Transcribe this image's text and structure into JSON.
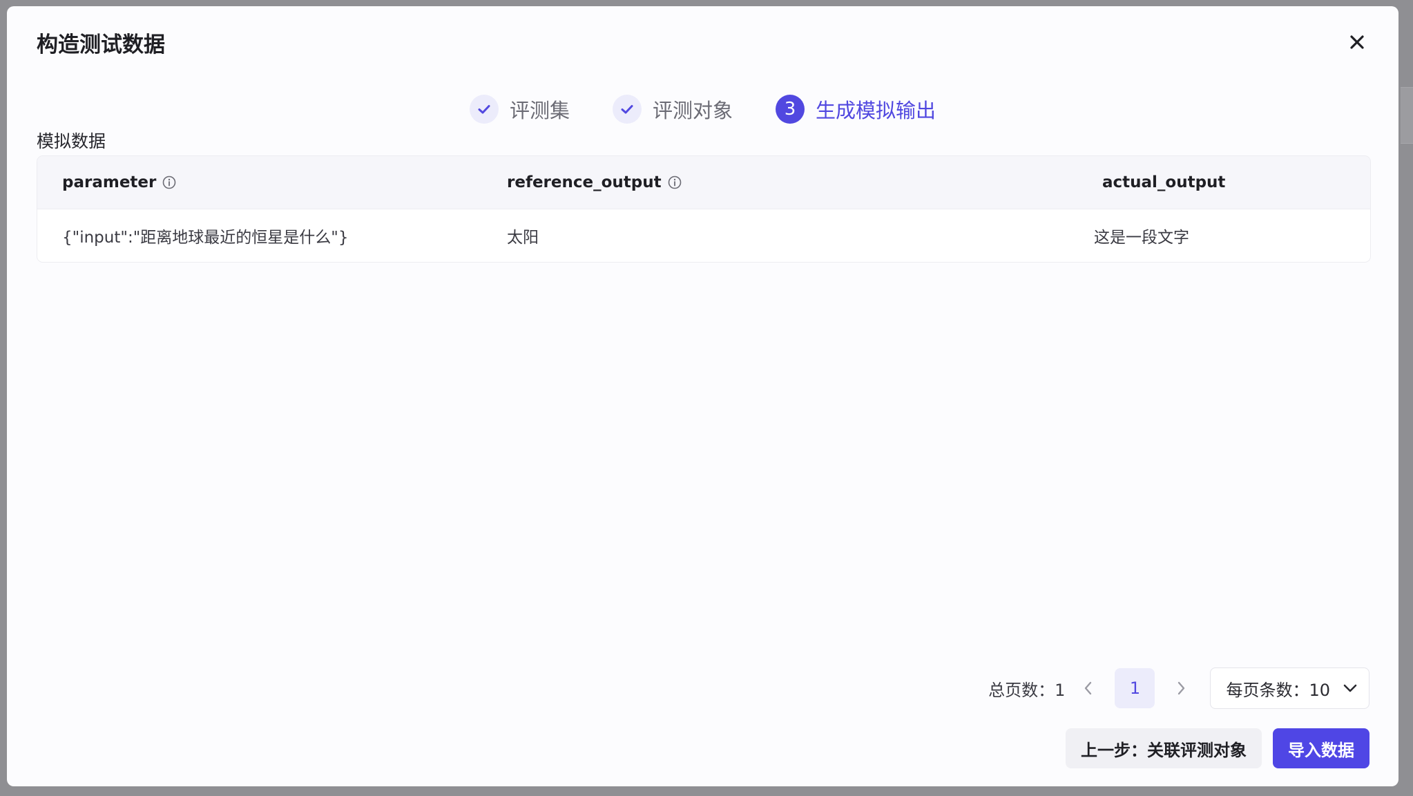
{
  "dialog": {
    "title": "构造测试数据"
  },
  "steps": [
    {
      "label": "评测集",
      "status": "done"
    },
    {
      "label": "评测对象",
      "status": "done"
    },
    {
      "label": "生成模拟输出",
      "status": "active",
      "number": "3"
    }
  ],
  "section": {
    "title": "模拟数据"
  },
  "table": {
    "columns": [
      "parameter",
      "reference_output",
      "actual_output"
    ],
    "rows": [
      [
        "{\"input\":\"距离地球最近的恒星是什么\"}",
        "太阳",
        "这是一段文字"
      ]
    ]
  },
  "pagination": {
    "total_label": "总页数：1",
    "current_page": "1",
    "page_size_label": "每页条数：10"
  },
  "footer": {
    "prev_label": "上一步：关联评测对象",
    "import_label": "导入数据"
  },
  "colors": {
    "accent": "#5148e0",
    "primary_button": "#4f46e5"
  }
}
